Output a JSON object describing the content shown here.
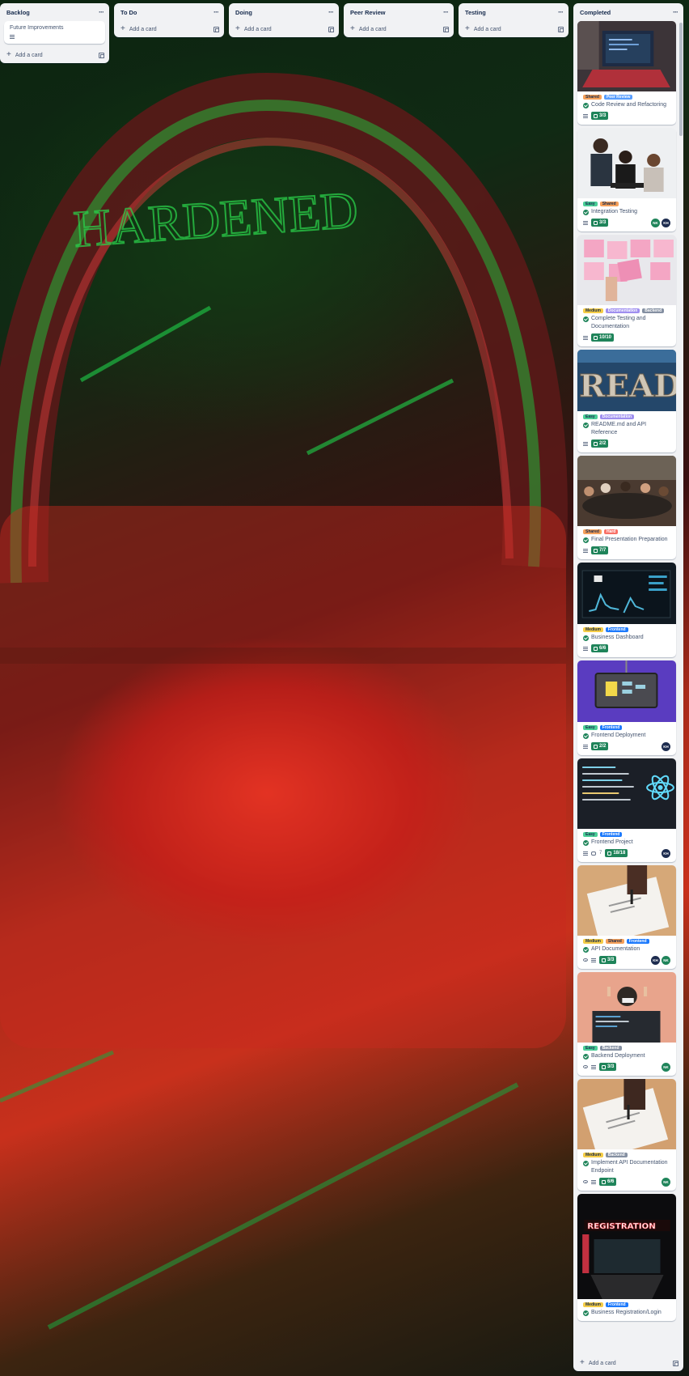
{
  "board": {
    "lists": [
      {
        "title": "Backlog",
        "cards": [
          {
            "title": "Future Improvements"
          }
        ],
        "add_card": "Add a card"
      },
      {
        "title": "To Do",
        "cards": [],
        "add_card": "Add a card"
      },
      {
        "title": "Doing",
        "cards": [],
        "add_card": "Add a card"
      },
      {
        "title": "Peer Review",
        "cards": [],
        "add_card": "Add a card"
      },
      {
        "title": "Testing",
        "cards": [],
        "add_card": "Add a card"
      },
      {
        "title": "Completed",
        "add_card": "Add a card",
        "cards": [
          {
            "cover": "laptop-code",
            "labels": [
              "Shared",
              "Peer Review"
            ],
            "title": "Code Review and Refactoring",
            "checklist": "3/3",
            "members": []
          },
          {
            "cover": "team-meeting",
            "labels": [
              "Easy",
              "Shared"
            ],
            "title": "Integration Testing",
            "checklist": "3/3",
            "members": [
              "NK",
              "KH"
            ]
          },
          {
            "cover": "sticky-notes",
            "labels": [
              "Medium",
              "Documentation",
              "Backend"
            ],
            "title": "Complete Testing and Documentation",
            "checklist": "10/10",
            "members": []
          },
          {
            "cover": "read-letters",
            "labels": [
              "Easy",
              "Documentation"
            ],
            "title": "README.md and API Reference",
            "checklist": "2/2",
            "members": []
          },
          {
            "cover": "conference-room",
            "labels": [
              "Shared",
              "Hard"
            ],
            "title": "Final Presentation Preparation",
            "checklist": "7/7",
            "members": []
          },
          {
            "cover": "dashboard-screen",
            "labels": [
              "Medium",
              "Frontend"
            ],
            "title": "Business Dashboard",
            "checklist": "6/6",
            "members": []
          },
          {
            "cover": "js-monitor",
            "labels": [
              "Easy",
              "Frontend"
            ],
            "title": "Frontend Deployment",
            "checklist": "2/2",
            "members": [
              "KH"
            ]
          },
          {
            "cover": "react-code",
            "labels": [
              "Easy",
              "Frontend"
            ],
            "title": "Frontend Project",
            "comments": "7",
            "checklist": "18/18",
            "members": [
              "KH"
            ]
          },
          {
            "cover": "signing-paper",
            "labels": [
              "Medium",
              "Shared",
              "Frontend"
            ],
            "title": "API Documentation",
            "watch": true,
            "checklist": "3/3",
            "members": [
              "KH",
              "NK"
            ]
          },
          {
            "cover": "coder-peace",
            "labels": [
              "Easy",
              "Backend"
            ],
            "title": "Backend Deployment",
            "watch": true,
            "checklist": "3/3",
            "members": [
              "NK"
            ]
          },
          {
            "cover": "signing-paper-2",
            "labels": [
              "Medium",
              "Backend"
            ],
            "title": "Implement API Documentation Endpoint",
            "watch": true,
            "checklist": "6/6",
            "members": [
              "NK"
            ]
          },
          {
            "cover": "registration-sign",
            "labels": [
              "Medium",
              "Frontend"
            ],
            "title": "Business Registration/Login"
          }
        ]
      }
    ]
  },
  "label_colors": {
    "Shared": "#f5a05a",
    "Peer Review": "#579dff",
    "Easy": "#4bce97",
    "Medium": "#f5cd47",
    "Hard": "#f87168",
    "Documentation": "#9f8fef",
    "Backend": "#8590a2",
    "Frontend": "#1d7afc"
  },
  "member_colors": {
    "NK": "#1f845a",
    "KH": "#1d2c4f"
  }
}
